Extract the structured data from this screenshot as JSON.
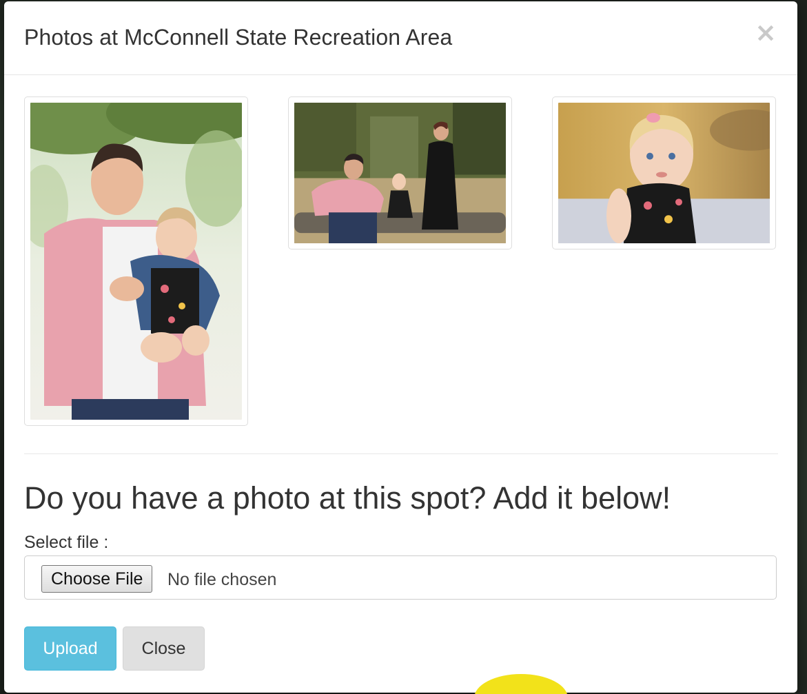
{
  "modal": {
    "title": "Photos at McConnell State Recreation Area",
    "close_icon": "×"
  },
  "photos": [
    {
      "alt": "photo-1",
      "icon": "photo-image"
    },
    {
      "alt": "photo-2",
      "icon": "photo-image"
    },
    {
      "alt": "photo-3",
      "icon": "photo-image"
    }
  ],
  "upload_section": {
    "heading": "Do you have a photo at this spot? Add it below!",
    "select_label": "Select file :",
    "choose_button": "Choose File",
    "no_file_text": "No file chosen"
  },
  "buttons": {
    "upload": "Upload",
    "close": "Close"
  },
  "colors": {
    "upload_accent": "#5bc0de",
    "close_bg": "#e0e0e0",
    "cursor_highlight": "#f2e21a"
  }
}
